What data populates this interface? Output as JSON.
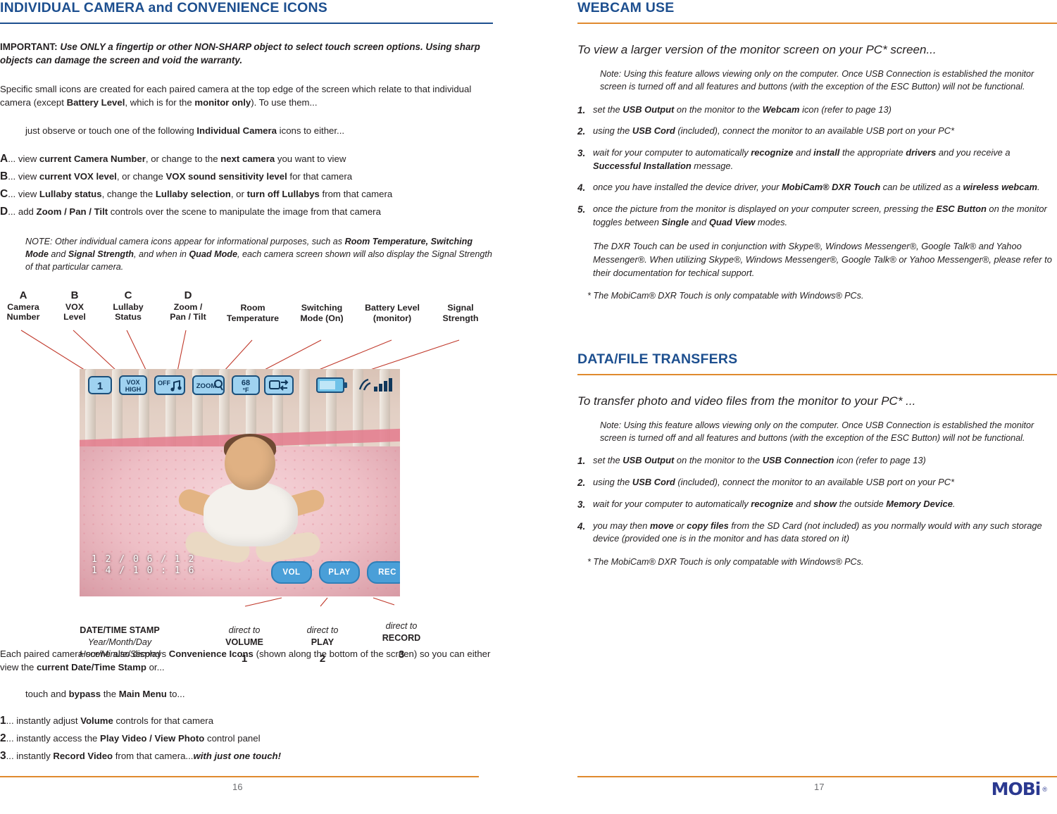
{
  "left": {
    "title": "INDIVIDUAL CAMERA and CONVENIENCE ICONS",
    "important_label": "IMPORTANT:",
    "important_text": "Use ONLY a fingertip or other NON-SHARP object to select touch screen options. Using sharp objects can damage the screen and void the warranty.",
    "intro": {
      "p1": "Specific small icons are created for each paired camera at the top edge of the screen which relate to that individual camera (except ",
      "b1": "Battery Level",
      "p2": ", which is for the ",
      "b2": "monitor only",
      "p3": "). To use them..."
    },
    "observe": {
      "p1": "just observe or touch one of the following ",
      "b1": "Individual Camera",
      "p2": " icons to either..."
    },
    "items": [
      {
        "letter": "A",
        "parts": [
          "... view ",
          "current Camera Number",
          ", or change to the ",
          "next camera",
          " you want to view"
        ]
      },
      {
        "letter": "B",
        "parts": [
          "... view ",
          "current VOX level",
          ", or change ",
          "VOX sound sensitivity level",
          " for that camera"
        ]
      },
      {
        "letter": "C",
        "parts": [
          "... view ",
          "Lullaby status",
          ", change the ",
          "Lullaby selection",
          ", or ",
          "turn off Lullabys",
          " from that camera"
        ]
      },
      {
        "letter": "D",
        "parts": [
          "... add ",
          "Zoom / Pan / Tilt",
          " controls over the scene to manipulate the image from that camera"
        ]
      }
    ],
    "note": {
      "t1": "NOTE: Other individual camera icons appear for informational purposes, such as ",
      "b1": "Room Temperature, Switching Mode",
      "t2": " and ",
      "b2": "Signal Strength",
      "t3": ", and when in ",
      "b3": "Quad Mode",
      "t4": ", each camera screen shown will also display the Signal Strength of that particular camera."
    },
    "fig_labels": [
      {
        "letter": "A",
        "lines": [
          "Camera",
          "Number"
        ]
      },
      {
        "letter": "B",
        "lines": [
          "VOX",
          "Level"
        ]
      },
      {
        "letter": "C",
        "lines": [
          "Lullaby",
          "Status"
        ]
      },
      {
        "letter": "D",
        "lines": [
          "Zoom /",
          "Pan / Tilt"
        ]
      },
      {
        "letter": "",
        "lines": [
          "Room",
          "Temperature"
        ]
      },
      {
        "letter": "",
        "lines": [
          "Switching",
          "Mode (On)"
        ]
      },
      {
        "letter": "",
        "lines": [
          "Battery Level",
          "(monitor)"
        ]
      },
      {
        "letter": "",
        "lines": [
          "Signal",
          "Strength"
        ]
      }
    ],
    "screen": {
      "icons": [
        {
          "name": "camera-number-icon",
          "text": "1"
        },
        {
          "name": "vox-level-icon",
          "text": "VOX HIGH"
        },
        {
          "name": "lullaby-status-icon",
          "text": "OFF"
        },
        {
          "name": "zoom-pan-tilt-icon",
          "text": "ZOOM"
        },
        {
          "name": "room-temperature-icon",
          "text": "68 °F"
        },
        {
          "name": "switching-mode-icon",
          "text": ""
        },
        {
          "name": "battery-level-icon",
          "text": ""
        },
        {
          "name": "signal-strength-icon",
          "text": ""
        }
      ],
      "timestamp_line1": "1 2 / 0 6 / 1 2",
      "timestamp_line2": "1 4 / 1 0 : 1 6",
      "buttons": [
        "VOL",
        "PLAY",
        "REC"
      ]
    },
    "under_labels": [
      {
        "title": "DATE/TIME STAMP",
        "sub1": "Year/Month/Day",
        "sub2": "Hour/Minute/Second",
        "num": ""
      },
      {
        "title": "direct to",
        "sub1": "VOLUME",
        "sub2": "",
        "num": "1"
      },
      {
        "title": "direct to",
        "sub1": "PLAY",
        "sub2": "",
        "num": "2"
      },
      {
        "title": "direct to",
        "sub1": "RECORD",
        "sub2": "",
        "num": "3"
      }
    ],
    "bottom": {
      "p1": "Each paired camera scene also displays ",
      "b1": "Convenience Icons",
      "p2": " (shown along the bottom of the screen) so you can either view the ",
      "b2": "current Date/Time Stamp",
      "p3": " or..."
    },
    "touch": {
      "p1": "touch and ",
      "b1": "bypass",
      "p2": " the ",
      "b2": "Main Menu",
      "p3": " to..."
    },
    "numbered": [
      {
        "num": "1",
        "parts": [
          "... instantly adjust ",
          "Volume",
          " controls for that camera"
        ]
      },
      {
        "num": "2",
        "parts": [
          "... instantly access the ",
          "Play Video / View Photo",
          " control panel"
        ]
      },
      {
        "num": "3",
        "parts": [
          "... instantly ",
          "Record Video",
          " from that camera...",
          "with just one touch!"
        ]
      }
    ],
    "page_number": "16"
  },
  "right": {
    "webcam": {
      "title": "WEBCAM USE",
      "lead": "To view a larger version of the monitor screen on your PC* screen...",
      "note": "Note: Using this feature allows viewing only on the computer. Once USB Connection is established the monitor screen is turned off and all features and buttons (with the exception of the ESC Button) will not be functional.",
      "steps": [
        {
          "num": "1.",
          "parts": [
            "set the ",
            "USB Output",
            " on the monitor to the ",
            "Webcam",
            " icon (refer to page 13)"
          ]
        },
        {
          "num": "2.",
          "parts": [
            " using the ",
            "USB Cord",
            " (included), connect the monitor to an available USB port on your PC*"
          ]
        },
        {
          "num": "3.",
          "parts": [
            " wait for your computer to automatically ",
            "recognize",
            " and ",
            "install",
            " the appropriate ",
            "drivers",
            " and you receive a ",
            "Successful Installation",
            " message."
          ]
        },
        {
          "num": "4.",
          "parts": [
            "once you have installed the device driver, your ",
            "MobiCam® DXR Touch",
            " can be utilized as a ",
            "wireless webcam",
            "."
          ]
        },
        {
          "num": "5.",
          "parts": [
            "once the picture from the monitor is displayed on your computer screen, pressing the ",
            "ESC Button",
            " on the monitor toggles between ",
            "Single",
            " and ",
            "Quad View",
            " modes."
          ]
        }
      ],
      "paragraph": "The DXR Touch can be used in conjunction with Skype®, Windows Messenger®, Google Talk® and Yahoo Messenger®. When utilizing Skype®, Windows Messenger®, Google Talk® or Yahoo Messenger®, please refer to their documentation for techical support.",
      "footnote": "* The MobiCam® DXR Touch is only compatable with Windows® PCs."
    },
    "data": {
      "title": "DATA/FILE TRANSFERS",
      "lead": "To transfer photo and video files from the monitor to your PC* ...",
      "note": "Note: Using this feature allows viewing only on the computer. Once USB Connection is established the monitor screen is turned off and all features and buttons (with the exception of the ESC Button) will not be functional.",
      "steps": [
        {
          "num": "1.",
          "parts": [
            "set the ",
            "USB Output",
            " on the monitor to the ",
            "USB Connection",
            " icon (refer to page 13)"
          ]
        },
        {
          "num": "2.",
          "parts": [
            " using the ",
            "USB Cord",
            " (included), connect the monitor to an available USB port on your PC*"
          ]
        },
        {
          "num": "3.",
          "parts": [
            " wait for your computer to automatically ",
            "recognize",
            " and ",
            "show",
            " the outside ",
            "Memory Device",
            "."
          ]
        },
        {
          "num": "4.",
          "parts": [
            "you may then ",
            "move",
            " or ",
            "copy files",
            " from the SD Card (not included) as you normally would with any such storage device (provided one is in the monitor and has data stored on it)"
          ]
        }
      ],
      "footnote": "* The MobiCam® DXR Touch is only compatable with Windows® PCs."
    },
    "page_number": "17",
    "brand": "MOBi",
    "brand_reg": "®"
  },
  "colors": {
    "heading_blue": "#1d4f8f",
    "rule_orange": "#e08a2e",
    "leader_red": "#c0392b",
    "body": "#231f20"
  }
}
